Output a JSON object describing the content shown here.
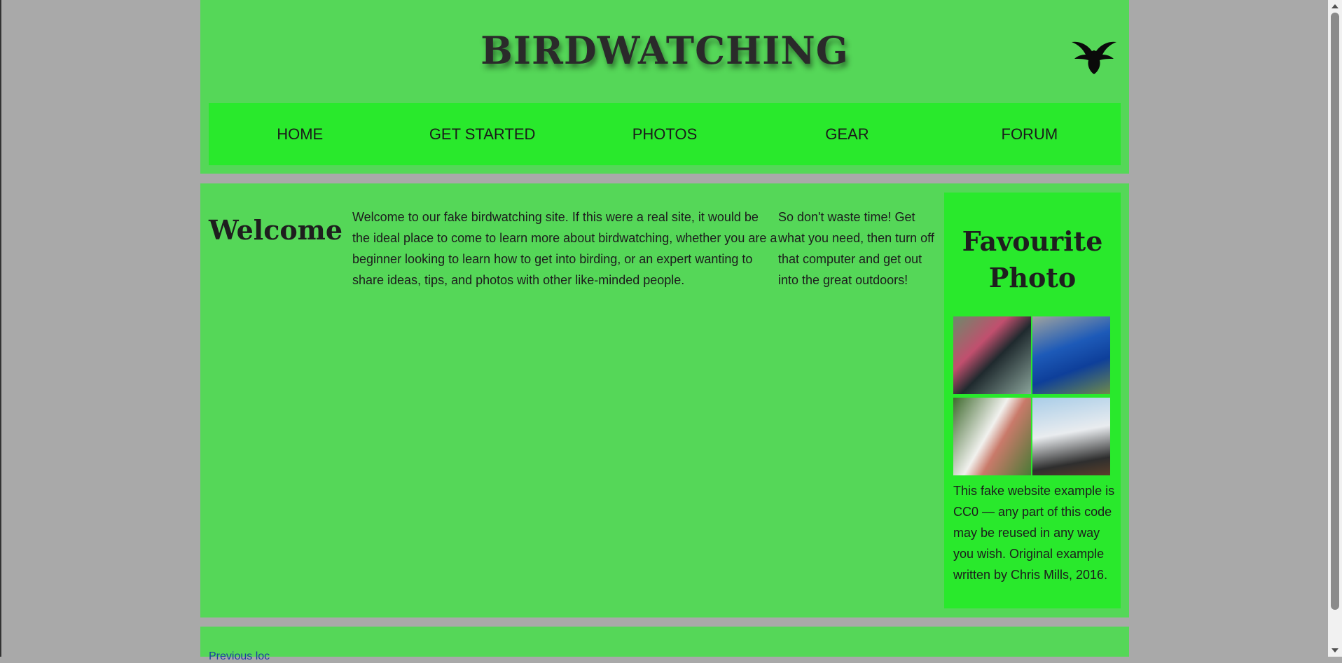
{
  "header": {
    "title": "BIRDWATCHING",
    "logo_icon": "bird-silhouette-icon"
  },
  "nav": {
    "items": [
      {
        "label": "HOME"
      },
      {
        "label": "GET STARTED"
      },
      {
        "label": "PHOTOS"
      },
      {
        "label": "GEAR"
      },
      {
        "label": "FORUM"
      }
    ]
  },
  "main": {
    "heading": "Welcome",
    "paragraph1": "Welcome to our fake birdwatching site. If this were a real site, it would be the ideal place to come to learn more about birdwatching, whether you are a beginner looking to learn how to get into birding, or an expert wanting to share ideas, tips, and photos with other like-minded people.",
    "paragraph2": "So don't waste time! Get what you need, then turn off that computer and get out into the great outdoors!"
  },
  "aside": {
    "heading": "Favourite Photo",
    "photos": [
      "tui-bird-photo",
      "peacock-photo",
      "white-ibis-photo",
      "stork-photo"
    ],
    "text": "This fake website example is CC0 — any part of this code may be reused in any way you wish. Original example written by Chris Mills, 2016."
  },
  "footer": {
    "link_text": "Previous loc"
  },
  "colors": {
    "page_bg": "#a9a9a9",
    "panel_bg": "#55d758",
    "accent_bg": "#29e92c"
  }
}
